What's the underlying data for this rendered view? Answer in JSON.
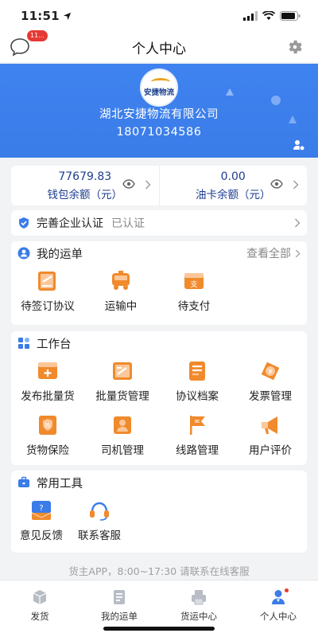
{
  "status_bar": {
    "time": "11:51"
  },
  "nav": {
    "title": "个人中心",
    "message_badge": "11..."
  },
  "profile": {
    "logo_text": "安捷物流",
    "company": "湖北安捷物流有限公司",
    "phone": "18071034586"
  },
  "balance": {
    "wallet_value": "77679.83",
    "wallet_label": "钱包余额（元）",
    "fuel_value": "0.00",
    "fuel_label": "油卡余额（元）"
  },
  "certification": {
    "title": "完善企业认证",
    "status": "已认证"
  },
  "orders": {
    "title": "我的运单",
    "view_all": "查看全部",
    "items": [
      {
        "label": "待签订协议",
        "icon": "contract-icon"
      },
      {
        "label": "运输中",
        "icon": "truck-icon"
      },
      {
        "label": "待支付",
        "icon": "payment-icon"
      }
    ]
  },
  "workbench": {
    "title": "工作台",
    "items": [
      {
        "label": "发布批量货",
        "icon": "publish-cargo-icon"
      },
      {
        "label": "批量货管理",
        "icon": "cargo-manage-icon"
      },
      {
        "label": "协议档案",
        "icon": "agreement-archive-icon"
      },
      {
        "label": "发票管理",
        "icon": "invoice-icon"
      },
      {
        "label": "货物保险",
        "icon": "insurance-icon"
      },
      {
        "label": "司机管理",
        "icon": "driver-icon"
      },
      {
        "label": "线路管理",
        "icon": "route-flag-icon"
      },
      {
        "label": "用户评价",
        "icon": "megaphone-icon"
      }
    ]
  },
  "tools": {
    "title": "常用工具",
    "items": [
      {
        "label": "意见反馈",
        "icon": "feedback-icon"
      },
      {
        "label": "联系客服",
        "icon": "headset-icon"
      }
    ]
  },
  "footer_note": "货主APP，8:00~17:30 请联系在线客服",
  "tabs": [
    {
      "label": "发货",
      "icon": "box-icon"
    },
    {
      "label": "我的运单",
      "icon": "order-doc-icon"
    },
    {
      "label": "货运中心",
      "icon": "printer-icon"
    },
    {
      "label": "个人中心",
      "icon": "person-icon",
      "active": true
    }
  ],
  "colors": {
    "primary": "#3a7ce8",
    "accent_orange": "#f08a2c",
    "text_blue": "#1d3d8f",
    "badge_red": "#e53935"
  }
}
